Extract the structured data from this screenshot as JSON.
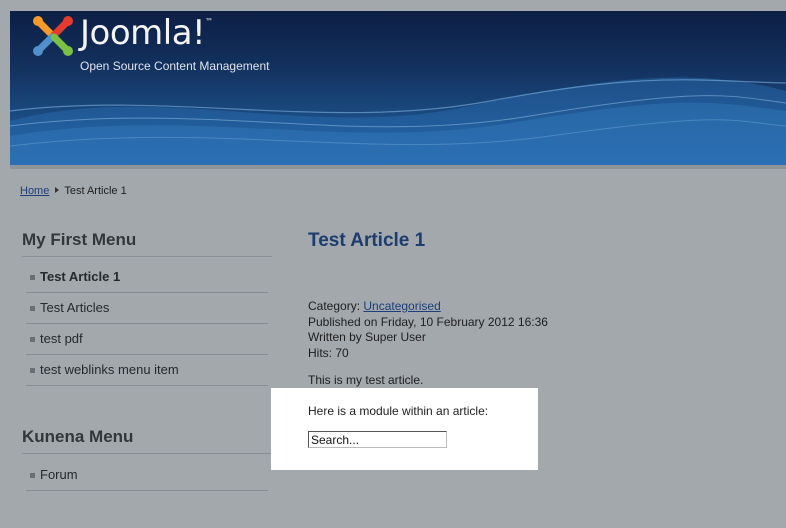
{
  "header": {
    "logo_text": "Joomla!",
    "logo_tm": "™",
    "tagline": "Open Source Content Management",
    "colors": {
      "background_dark": "#0d1f44",
      "background_light": "#1e5fa0"
    }
  },
  "breadcrumb": {
    "home": "Home",
    "current": "Test Article 1"
  },
  "sidebar": {
    "menus": [
      {
        "title": "My First Menu",
        "items": [
          {
            "label": "Test Article 1",
            "active": true
          },
          {
            "label": "Test Articles",
            "active": false
          },
          {
            "label": "test pdf",
            "active": false
          },
          {
            "label": "test weblinks menu item",
            "active": false
          }
        ]
      },
      {
        "title": "Kunena Menu",
        "items": [
          {
            "label": "Forum",
            "active": false
          }
        ]
      }
    ]
  },
  "article": {
    "title": "Test Article 1",
    "category_label": "Category: ",
    "category": "Uncategorised",
    "published": "Published on Friday, 10 February 2012 16:36",
    "written_by": "Written by Super User",
    "hits": "Hits: 70",
    "body": "This is my test article."
  },
  "module": {
    "text": "Here is a module within an article:",
    "search_placeholder": "Search..."
  },
  "icons": {
    "logo": "joomla-logo-icon",
    "breadcrumb_separator": "arrow-right-icon",
    "menu_bullet": "square-bullet-icon"
  }
}
